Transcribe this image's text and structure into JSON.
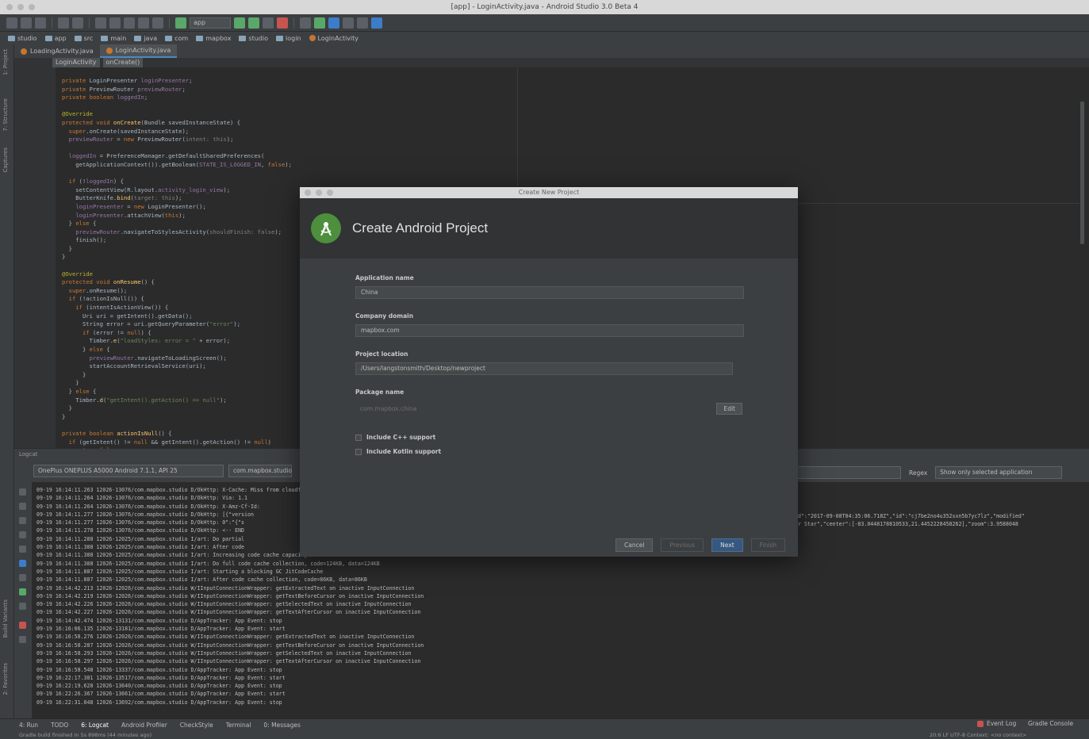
{
  "window": {
    "title": "[app] - LoginActivity.java - Android Studio 3.0 Beta 4"
  },
  "toolbar": {
    "run_config": "app"
  },
  "breadcrumbs": [
    "studio",
    "app",
    "src",
    "main",
    "java",
    "com",
    "mapbox",
    "studio",
    "login",
    "LoginActivity"
  ],
  "editor": {
    "tabs": [
      {
        "label": "LoadingActivity.java",
        "active": false
      },
      {
        "label": "LoginActivity.java",
        "active": true
      }
    ],
    "method_bar": [
      "LoginActivity",
      "onCreate()"
    ]
  },
  "logcat": {
    "panel_title": "Logcat",
    "device": "OnePlus ONEPLUS A5000 Android 7.1.1, API 25",
    "process": "com.mapbox.studio",
    "regex_label": "Regex",
    "filter": "Show only selected application"
  },
  "dialog": {
    "window_title": "Create New Project",
    "heading": "Create Android Project",
    "fields": {
      "app_name_label": "Application name",
      "app_name_value": "China",
      "domain_label": "Company domain",
      "domain_value": "mapbox.com",
      "location_label": "Project location",
      "location_value": "/Users/langstonsmith/Desktop/newproject",
      "package_label": "Package name",
      "package_value": "com.mapbox.china",
      "edit_label": "Edit"
    },
    "checkboxes": [
      {
        "label": "Include C++ support",
        "checked": false
      },
      {
        "label": "Include Kotlin support",
        "checked": false
      }
    ],
    "buttons": {
      "cancel": "Cancel",
      "previous": "Previous",
      "next": "Next",
      "finish": "Finish"
    }
  },
  "bottom_tabs": [
    "4: Run",
    "TODO",
    "6: Logcat",
    "Android Profiler",
    "CheckStyle",
    "Terminal",
    "0: Messages"
  ],
  "bottom_right": {
    "event_log": "Event Log",
    "gradle_console": "Gradle Console"
  },
  "status": {
    "message": "Gradle build finished in 5s 898ms (44 minutes ago)",
    "position": "20:6  LF  UTF-8  Context: <no context>"
  }
}
